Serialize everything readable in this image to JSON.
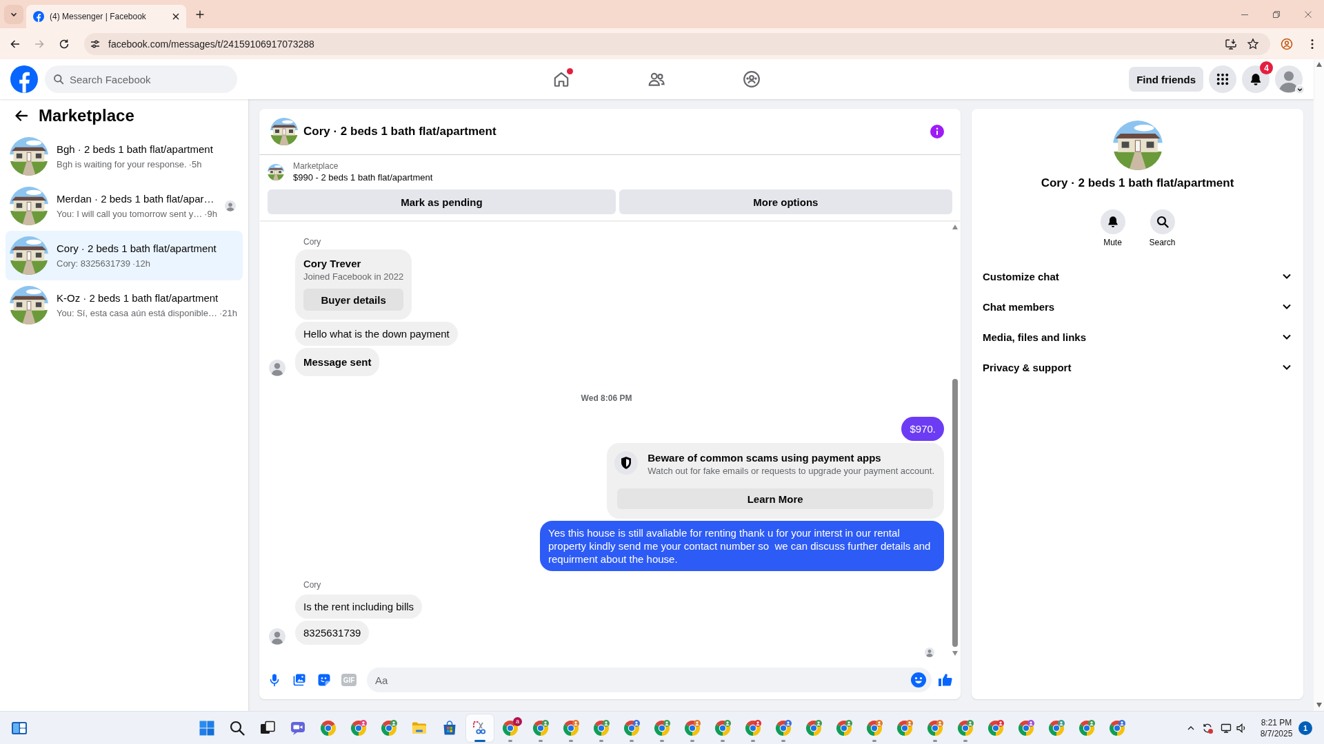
{
  "browser": {
    "tab": {
      "title": "(4) Messenger | Facebook",
      "selected": true
    },
    "forward_disabled": true,
    "url": "facebook.com/messages/t/24159106917073288"
  },
  "header": {
    "search": {
      "placeholder": "Search Facebook"
    },
    "nav": [
      {
        "kind": "home",
        "selected": false,
        "dot": true
      },
      {
        "kind": "friends",
        "selected": false,
        "dot": false
      },
      {
        "kind": "groups",
        "selected": false,
        "dot": false
      }
    ],
    "find_friends": "Find friends",
    "notification_count": "4"
  },
  "sidebar": {
    "title": "Marketplace",
    "conversations": [
      {
        "title": "Bgh · 2 beds 1 bath flat/apartment",
        "preview": "Bgh is waiting for your response.",
        "time": "·5h",
        "selected": false,
        "seen": false
      },
      {
        "title": "Merdan · 2 beds 1 bath flat/apar…",
        "preview": "You: I will call you tomorrow sent y…",
        "time": "·9h",
        "selected": false,
        "seen": true
      },
      {
        "title": "Cory · 2 beds 1 bath flat/apartment",
        "preview": "Cory: 8325631739",
        "time": "·12h",
        "selected": true,
        "seen": false
      },
      {
        "title": "K-Oz · 2 beds 1 bath flat/apartment",
        "preview": "You: Sí, esta casa aún está disponible…",
        "time": "·21h",
        "selected": false,
        "seen": false
      }
    ]
  },
  "chat": {
    "title": "Cory · 2 beds 1 bath flat/apartment",
    "listing": {
      "source": "Marketplace",
      "summary": "$990 - 2 beds 1 bath flat/apartment"
    },
    "actions": [
      "Mark as pending",
      "More options"
    ],
    "messages": [
      {
        "kind": "sender",
        "text": "Cory"
      },
      {
        "kind": "buyer_card",
        "name": "Cory Trever",
        "subtitle": "Joined Facebook in 2022",
        "button": "Buyer details"
      },
      {
        "kind": "incoming",
        "text": "Hello what is the down payment",
        "strong": false,
        "avatar": false
      },
      {
        "kind": "incoming",
        "text": "Message sent",
        "strong": true,
        "avatar": true
      },
      {
        "kind": "timestamp",
        "text": "Wed 8:06 PM"
      },
      {
        "kind": "outgoing",
        "text": "$970.",
        "color": "#6c3cf4"
      },
      {
        "kind": "notice",
        "title": "Beware of common scams using payment apps",
        "body": "Watch out for fake emails or requests to upgrade your payment account.",
        "button": "Learn More"
      },
      {
        "kind": "outgoing",
        "text": "Yes this house is still avaliable for renting thank u for your interst in our rental property kindly send me your contact number so  we can discuss further details and requirment about the house.",
        "color": "#2d5bf5"
      },
      {
        "kind": "sender",
        "text": "Cory"
      },
      {
        "kind": "incoming",
        "text": "Is the rent including bills",
        "strong": false,
        "avatar": false
      },
      {
        "kind": "incoming",
        "text": "8325631739",
        "strong": false,
        "avatar": true
      },
      {
        "kind": "seen"
      }
    ],
    "composer": {
      "gif_label": "GIF",
      "placeholder": "Aa"
    }
  },
  "details": {
    "title": "Cory · 2 beds 1 bath flat/apartment",
    "actions": [
      {
        "kind": "mute",
        "label": "Mute"
      },
      {
        "kind": "search",
        "label": "Search"
      }
    ],
    "sections": [
      {
        "label": "Customize chat",
        "expanded": false
      },
      {
        "label": "Chat members",
        "expanded": false
      },
      {
        "label": "Media, files and links",
        "expanded": false
      },
      {
        "label": "Privacy & support",
        "expanded": false
      }
    ]
  },
  "taskbar": {
    "left_apps": [
      {
        "kind": "widgets",
        "selected": false
      }
    ],
    "apps": [
      {
        "kind": "start",
        "selected": false,
        "running": false
      },
      {
        "kind": "search",
        "selected": false,
        "running": false
      },
      {
        "kind": "task_view",
        "selected": false,
        "running": false
      },
      {
        "kind": "chat",
        "selected": false,
        "running": false
      },
      {
        "kind": "chrome",
        "selected": false,
        "running": false
      },
      {
        "kind": "chrome",
        "selected": false,
        "running": false,
        "color": "#e0457b"
      },
      {
        "kind": "chrome",
        "selected": false,
        "running": false,
        "color": "#3f9a57"
      },
      {
        "kind": "explorer",
        "selected": false,
        "running": false
      },
      {
        "kind": "store",
        "selected": false,
        "running": false
      },
      {
        "kind": "snipping",
        "selected": true,
        "running": true
      },
      {
        "kind": "chrome",
        "selected": false,
        "running": true,
        "color": "#b0124e",
        "badge_text": "a"
      },
      {
        "kind": "chrome",
        "selected": false,
        "running": true,
        "color": "#3f9a57"
      },
      {
        "kind": "chrome",
        "selected": false,
        "running": true,
        "color": "#e0792a"
      },
      {
        "kind": "chrome",
        "selected": false,
        "running": true,
        "color": "#3f9a57"
      },
      {
        "kind": "chrome",
        "selected": false,
        "running": true,
        "color": "#3b6fd8"
      },
      {
        "kind": "chrome",
        "selected": false,
        "running": true,
        "color": "#3f9a57"
      },
      {
        "kind": "chrome",
        "selected": false,
        "running": true,
        "color": "#e0792a"
      },
      {
        "kind": "chrome",
        "selected": false,
        "running": true,
        "color": "#3f9a57"
      },
      {
        "kind": "chrome",
        "selected": false,
        "running": true,
        "color": "#e0303c"
      },
      {
        "kind": "chrome",
        "selected": false,
        "running": true,
        "color": "#3b6fd8"
      },
      {
        "kind": "chrome",
        "selected": false,
        "running": false,
        "color": "#3f9a57"
      },
      {
        "kind": "chrome",
        "selected": false,
        "running": false,
        "color": "#3f9a57"
      },
      {
        "kind": "chrome",
        "selected": false,
        "running": true,
        "color": "#e0792a"
      },
      {
        "kind": "chrome",
        "selected": false,
        "running": false,
        "color": "#e0792a"
      },
      {
        "kind": "chrome",
        "selected": false,
        "running": true,
        "color": "#e0792a"
      },
      {
        "kind": "chrome",
        "selected": false,
        "running": true,
        "color": "#3f9a57"
      },
      {
        "kind": "chrome",
        "selected": false,
        "running": false,
        "color": "#e0303c"
      },
      {
        "kind": "chrome",
        "selected": false,
        "running": false,
        "color": "#9b4fd0"
      },
      {
        "kind": "chrome",
        "selected": false,
        "running": false,
        "color": "#3a9a8c"
      },
      {
        "kind": "chrome",
        "selected": false,
        "running": false,
        "color": "#3f9a57"
      },
      {
        "kind": "chrome",
        "selected": false,
        "running": false,
        "color": "#3b6fd8"
      }
    ],
    "time": "8:21 PM",
    "date": "8/7/2025",
    "notification_count": "1"
  }
}
